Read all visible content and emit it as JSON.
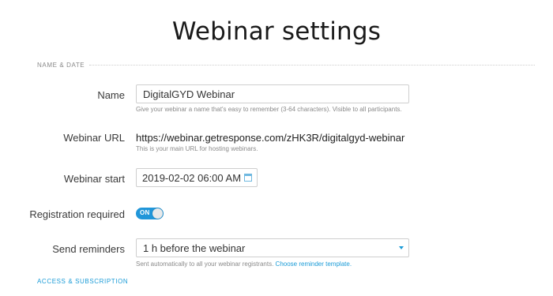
{
  "page": {
    "title": "Webinar settings"
  },
  "sections": {
    "name_date": {
      "label": "NAME & DATE"
    },
    "access_subscription": {
      "label": "ACCESS & SUBSCRIPTION"
    }
  },
  "fields": {
    "name": {
      "label": "Name",
      "value": "DigitalGYD Webinar",
      "hint": "Give your webinar a name that's easy to remember (3-64 characters). Visible to all participants."
    },
    "webinar_url": {
      "label": "Webinar URL",
      "value": "https://webinar.getresponse.com/zHK3R/digitalgyd-webinar",
      "hint": "This is your main URL for hosting webinars."
    },
    "webinar_start": {
      "label": "Webinar start",
      "value": "2019-02-02 06:00 AM",
      "icon": "calendar-icon"
    },
    "registration_required": {
      "label": "Registration required",
      "toggle_text": "ON",
      "state": true
    },
    "send_reminders": {
      "label": "Send reminders",
      "selected": "1 h before the webinar",
      "hint": "Sent automatically to all your webinar registrants.",
      "hint_link": "Choose reminder template."
    }
  },
  "colors": {
    "accent": "#2196d9",
    "link": "#1a9bd7",
    "muted_text": "#8a8a8a",
    "border": "#cfcfcf"
  }
}
